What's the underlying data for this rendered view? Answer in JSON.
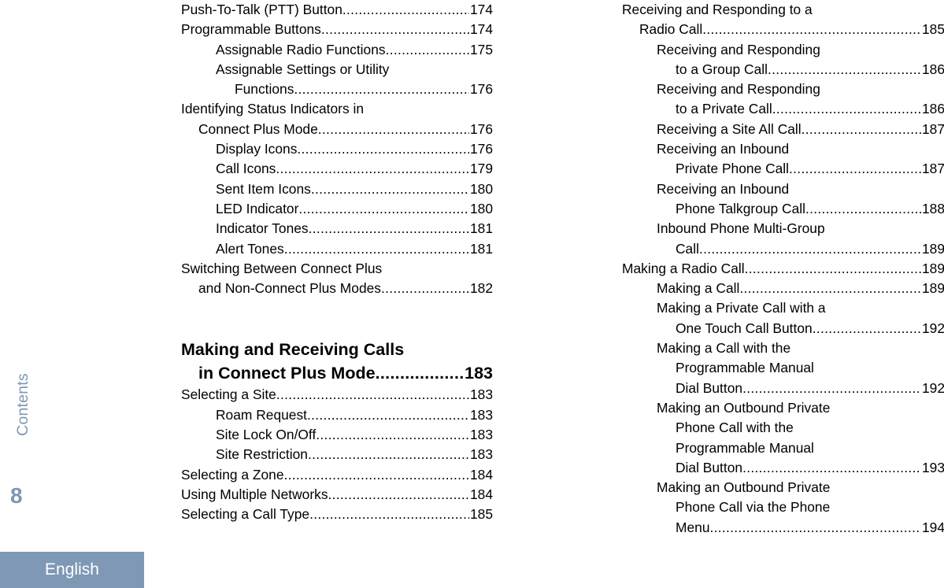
{
  "sidebar": {
    "tab_label": "Contents",
    "page_number": "8",
    "language_label": "English",
    "accent_color": "#7e98b5",
    "tab_text_color": "#7d97b5"
  },
  "toc": {
    "left_column": [
      {
        "lines": [
          {
            "text": "Push-To-Talk (PTT) Button",
            "indent": 0,
            "dots": true,
            "page": "174"
          }
        ]
      },
      {
        "lines": [
          {
            "text": "Programmable Buttons",
            "indent": 0,
            "dots": true,
            "page": "174"
          }
        ]
      },
      {
        "lines": [
          {
            "text": "Assignable Radio Functions",
            "indent": 2,
            "dots": true,
            "page": "175"
          }
        ]
      },
      {
        "lines": [
          {
            "text": "Assignable Settings or Utility",
            "indent": 2,
            "dots": false,
            "page": ""
          },
          {
            "text": "Functions",
            "indent": 3,
            "dots": true,
            "page": "176"
          }
        ]
      },
      {
        "lines": [
          {
            "text": "Identifying Status Indicators in",
            "indent": 0,
            "dots": false,
            "page": ""
          },
          {
            "text": "Connect Plus Mode",
            "indent": 1,
            "dots": true,
            "page": "176"
          }
        ]
      },
      {
        "lines": [
          {
            "text": "Display Icons",
            "indent": 2,
            "dots": true,
            "page": "176"
          }
        ]
      },
      {
        "lines": [
          {
            "text": "Call Icons",
            "indent": 2,
            "dots": true,
            "page": "179"
          }
        ]
      },
      {
        "lines": [
          {
            "text": "Sent Item Icons ",
            "indent": 2,
            "dots": true,
            "page": "180"
          }
        ]
      },
      {
        "lines": [
          {
            "text": "LED Indicator",
            "indent": 2,
            "dots": true,
            "page": "180"
          }
        ]
      },
      {
        "lines": [
          {
            "text": "Indicator Tones",
            "indent": 2,
            "dots": true,
            "page": "181"
          }
        ]
      },
      {
        "lines": [
          {
            "text": "Alert Tones",
            "indent": 2,
            "dots": true,
            "page": "181"
          }
        ]
      },
      {
        "lines": [
          {
            "text": "Switching Between Connect Plus",
            "indent": 0,
            "dots": false,
            "page": ""
          },
          {
            "text": "and Non-Connect Plus Modes",
            "indent": 1,
            "dots": true,
            "page": "182"
          }
        ]
      },
      {
        "heading": true,
        "gap_before": true,
        "lines": [
          {
            "text": "Making and Receiving Calls",
            "indent": 0,
            "dots": false,
            "page": ""
          },
          {
            "text": "in Connect Plus Mode",
            "indent": 1,
            "dots": true,
            "page": "183"
          }
        ]
      },
      {
        "lines": [
          {
            "text": "Selecting a Site",
            "indent": 0,
            "dots": true,
            "page": "183"
          }
        ]
      },
      {
        "lines": [
          {
            "text": "Roam Request",
            "indent": 2,
            "dots": true,
            "page": "183"
          }
        ]
      },
      {
        "lines": [
          {
            "text": "Site Lock On/Off",
            "indent": 2,
            "dots": true,
            "page": "183"
          }
        ]
      },
      {
        "lines": [
          {
            "text": "Site Restriction",
            "indent": 2,
            "dots": true,
            "page": "183"
          }
        ]
      },
      {
        "lines": [
          {
            "text": "Selecting a Zone",
            "indent": 0,
            "dots": true,
            "page": "184"
          }
        ]
      },
      {
        "lines": [
          {
            "text": "Using Multiple Networks",
            "indent": 0,
            "dots": true,
            "page": "184"
          }
        ]
      },
      {
        "lines": [
          {
            "text": "Selecting a Call Type",
            "indent": 0,
            "dots": true,
            "page": "185"
          }
        ]
      }
    ],
    "right_column": [
      {
        "lines": [
          {
            "text": "Receiving and Responding to a",
            "indent": 0,
            "dots": false,
            "page": ""
          },
          {
            "text": "Radio Call",
            "indent": 1,
            "dots": true,
            "page": "185"
          }
        ]
      },
      {
        "lines": [
          {
            "text": "Receiving and Responding",
            "indent": 2,
            "dots": false,
            "page": ""
          },
          {
            "text": "to a Group Call",
            "indent": 3,
            "dots": true,
            "page": "186"
          }
        ]
      },
      {
        "lines": [
          {
            "text": "Receiving and Responding",
            "indent": 2,
            "dots": false,
            "page": ""
          },
          {
            "text": "to a Private Call",
            "indent": 3,
            "dots": true,
            "page": "186"
          }
        ]
      },
      {
        "lines": [
          {
            "text": "Receiving a Site All Call",
            "indent": 2,
            "dots": true,
            "page": "187"
          }
        ]
      },
      {
        "lines": [
          {
            "text": "Receiving an Inbound",
            "indent": 2,
            "dots": false,
            "page": ""
          },
          {
            "text": "Private Phone Call",
            "indent": 3,
            "dots": true,
            "page": "187"
          }
        ]
      },
      {
        "lines": [
          {
            "text": "Receiving an Inbound",
            "indent": 2,
            "dots": false,
            "page": ""
          },
          {
            "text": "Phone Talkgroup Call",
            "indent": 3,
            "dots": true,
            "page": "188"
          }
        ]
      },
      {
        "lines": [
          {
            "text": "Inbound Phone Multi-Group",
            "indent": 2,
            "dots": false,
            "page": ""
          },
          {
            "text": "Call",
            "indent": 3,
            "dots": true,
            "page": "189"
          }
        ]
      },
      {
        "lines": [
          {
            "text": "Making a Radio Call",
            "indent": 0,
            "dots": true,
            "page": "189"
          }
        ]
      },
      {
        "lines": [
          {
            "text": "Making a Call ",
            "indent": 2,
            "dots": true,
            "page": "189"
          }
        ]
      },
      {
        "lines": [
          {
            "text": "Making a Private Call with a",
            "indent": 2,
            "dots": false,
            "page": ""
          },
          {
            "text": "One Touch Call Button",
            "indent": 3,
            "dots": true,
            "page": "192"
          }
        ]
      },
      {
        "lines": [
          {
            "text": "Making a Call with the",
            "indent": 2,
            "dots": false,
            "page": ""
          },
          {
            "text": "Programmable Manual",
            "indent": 3,
            "dots": false,
            "page": ""
          },
          {
            "text": "Dial Button",
            "indent": 3,
            "dots": true,
            "page": "192"
          }
        ]
      },
      {
        "lines": [
          {
            "text": "Making an Outbound Private",
            "indent": 2,
            "dots": false,
            "page": ""
          },
          {
            "text": "Phone Call with the",
            "indent": 3,
            "dots": false,
            "page": ""
          },
          {
            "text": "Programmable Manual",
            "indent": 3,
            "dots": false,
            "page": ""
          },
          {
            "text": "Dial Button",
            "indent": 3,
            "dots": true,
            "page": "193"
          }
        ]
      },
      {
        "lines": [
          {
            "text": "Making an Outbound Private",
            "indent": 2,
            "dots": false,
            "page": ""
          },
          {
            "text": "Phone Call via the Phone",
            "indent": 3,
            "dots": false,
            "page": ""
          },
          {
            "text": "Menu",
            "indent": 3,
            "dots": true,
            "page": "194"
          }
        ]
      }
    ]
  }
}
